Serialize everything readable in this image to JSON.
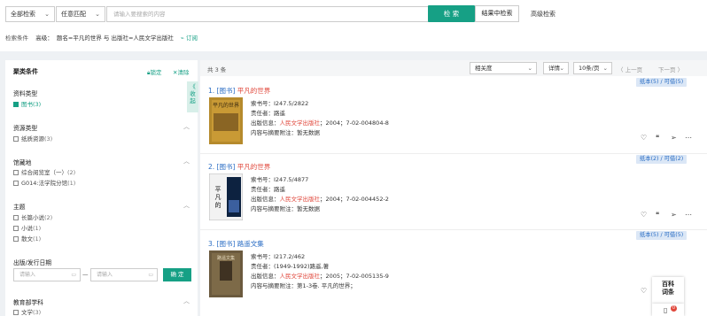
{
  "search": {
    "scope": "全部检索",
    "match": "任意匹配",
    "placeholder": "请输入要搜索的内容",
    "search_btn": "检 索",
    "in_result_btn": "结果中检索",
    "advanced": "高级检索"
  },
  "conditions": {
    "label": "检索条件",
    "mode": "高级：",
    "query": "题名=平凡的世界 与 出版社=人民文学出版社",
    "subscribe": "订阅"
  },
  "facets": {
    "title": "聚类条件",
    "lock": "锁定",
    "clear": "清除",
    "collapse": [
      "《",
      "收",
      "起"
    ],
    "groups": [
      {
        "name": "资料类型",
        "items": [
          {
            "label": "图书",
            "count": "(3)",
            "checked": true
          }
        ]
      },
      {
        "name": "资源类型",
        "items": [
          {
            "label": "纸质资源",
            "count": "(3)",
            "checked": false
          }
        ]
      },
      {
        "name": "馆藏地",
        "items": [
          {
            "label": "综合阅览室（一）",
            "count": "(2)",
            "checked": false
          },
          {
            "label": "G014:法学院分馆",
            "count": "(1)",
            "checked": false
          }
        ]
      },
      {
        "name": "主题",
        "items": [
          {
            "label": "长篇小说",
            "count": "(2)",
            "checked": false
          },
          {
            "label": "小说",
            "count": "(1)",
            "checked": false
          },
          {
            "label": "散文",
            "count": "(1)",
            "checked": false
          }
        ]
      },
      {
        "name": "出版/发行日期",
        "items": []
      },
      {
        "name": "教育部学科",
        "items": [
          {
            "label": "文学",
            "count": "(3)",
            "checked": false
          }
        ]
      }
    ],
    "date_from_ph": "请输入",
    "date_to_ph": "请输入",
    "date_sep": "—",
    "ok_btn": "确 定"
  },
  "results": {
    "total": "共 3 条",
    "sort": "相关度",
    "view": "详情",
    "page_size": "10条/页",
    "prev": "〈 上一页",
    "next": "下一页 〉",
    "records": [
      {
        "num": "1.",
        "tag": "[图书]",
        "title": "平凡的世界",
        "call_label": "索书号：",
        "call": "I247.5/2822",
        "resp_label": "责任者：",
        "resp": "路遥",
        "pub_label": "出版信息：",
        "publisher": "人民文学出版社",
        "pub_rest": "；2004；7-02-004804-8",
        "note_label": "内容与摘要附注：",
        "note": "暂无数据",
        "badge": "纸本(5) / 可借(5)"
      },
      {
        "num": "2.",
        "tag": "[图书]",
        "title": "平凡的世界",
        "call_label": "索书号：",
        "call": "I247.5/4877",
        "resp_label": "责任者：",
        "resp": "路遥",
        "pub_label": "出版信息：",
        "publisher": "人民文学出版社",
        "pub_rest": "；2004；7-02-004452-2",
        "note_label": "内容与摘要附注：",
        "note": "暂无数据",
        "badge": "纸本(2) / 可借(2)"
      },
      {
        "num": "3.",
        "tag": "[图书]",
        "title": "路遥文集",
        "call_label": "索书号：",
        "call": "I217.2/462",
        "resp_label": "责任者：",
        "resp": "(1949-1992)路遥,著",
        "pub_label": "出版信息：",
        "publisher": "人民文学出版社",
        "pub_rest": "；2005；7-02-005135-9",
        "note_label": "内容与摘要附注：",
        "note": "第1-3卷. 平凡的世界；",
        "badge": "纸本(5) / 可借(5)"
      }
    ]
  },
  "float": {
    "line1": "百科",
    "line2": "词条",
    "badge": "0"
  }
}
